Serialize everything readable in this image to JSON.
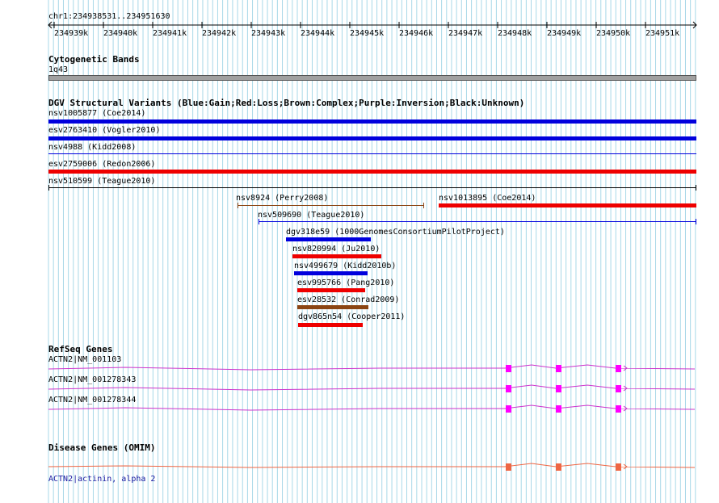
{
  "ruler": {
    "coord_label": "chr1:234938531..234951630",
    "ticks": [
      "234939k",
      "234940k",
      "234941k",
      "234942k",
      "234943k",
      "234944k",
      "234945k",
      "234946k",
      "234947k",
      "234948k",
      "234949k",
      "234950k",
      "234951k"
    ]
  },
  "cytoband": {
    "title": "Cytogenetic Bands",
    "band": "1q43"
  },
  "dgv": {
    "title": "DGV Structural Variants (Blue:Gain;Red:Loss;Brown:Complex;Purple:Inversion;Black:Unknown)",
    "variants": [
      {
        "label": "nsv1005877 (Coe2014)",
        "type": "gain"
      },
      {
        "label": "esv2763410 (Vogler2010)",
        "type": "gain"
      },
      {
        "label": "nsv4988 (Kidd2008)",
        "type": "gain"
      },
      {
        "label": "esv2759006 (Redon2006)",
        "type": "loss"
      },
      {
        "label": "nsv510599 (Teague2010)",
        "type": "unknown"
      },
      {
        "label": "nsv8924 (Perry2008)",
        "type": "complex"
      },
      {
        "label": "nsv1013895 (Coe2014)",
        "type": "loss"
      },
      {
        "label": "nsv509690 (Teague2010)",
        "type": "gain"
      },
      {
        "label": "dgv318e59 (1000GenomesConsortiumPilotProject)",
        "type": "gain"
      },
      {
        "label": "nsv820994 (Ju2010)",
        "type": "loss"
      },
      {
        "label": "nsv499679 (Kidd2010b)",
        "type": "gain"
      },
      {
        "label": "esv995766 (Pang2010)",
        "type": "loss"
      },
      {
        "label": "esv28532 (Conrad2009)",
        "type": "complex"
      },
      {
        "label": "dgv865n54 (Cooper2011)",
        "type": "loss"
      }
    ]
  },
  "refseq": {
    "title": "RefSeq Genes",
    "genes": [
      "ACTN2|NM_001103",
      "ACTN2|NM_001278343",
      "ACTN2|NM_001278344"
    ]
  },
  "omim": {
    "title": "Disease Genes (OMIM)",
    "gene": "ACTN2|actinin, alpha 2"
  },
  "colors": {
    "gain": "#0000dd",
    "loss": "#ee0000",
    "complex": "#8b4513",
    "unknown": "#000000",
    "grid": "#a8d8e8",
    "cytoband": "#a0a0a0",
    "refseq": "#cc33cc",
    "refseq_exon": "#ff00ff",
    "omim": "#ee6644",
    "omim_label": "#1a1aa0"
  }
}
